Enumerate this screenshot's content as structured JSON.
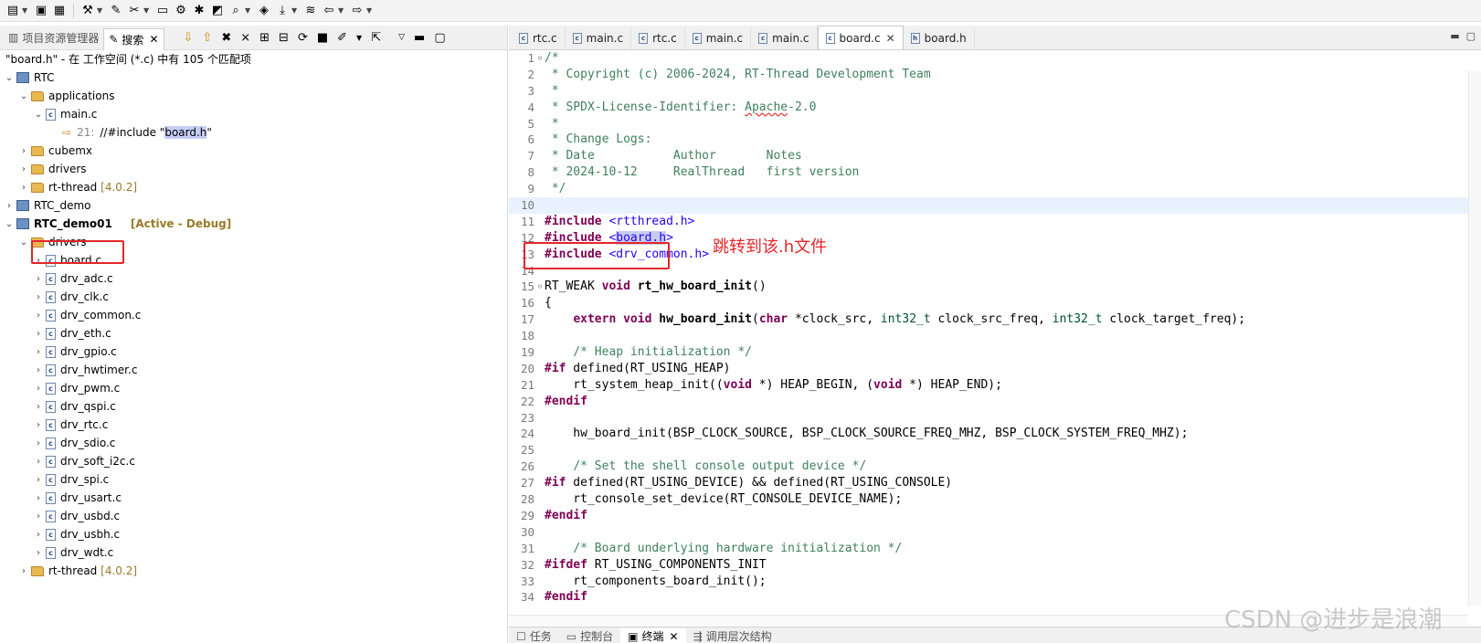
{
  "left_panel": {
    "tabs": [
      {
        "label": "项目资源管理器"
      },
      {
        "label": "搜索"
      }
    ],
    "summary": "\"board.h\" -  在 工作空间  (*.c)  中有 105 个匹配项",
    "tree": {
      "rtc": "RTC",
      "applications": "applications",
      "main_c": "main.c",
      "match_line": "21:",
      "match_prefix": "//#include \"",
      "match_highlight": "board.h",
      "match_suffix": "\"",
      "cubemx": "cubemx",
      "drivers": "drivers",
      "rt_thread": "rt-thread",
      "rt_thread_version": "[4.0.2]",
      "rtc_demo": "RTC_demo",
      "rtc_demo01": "RTC_demo01",
      "rtc_demo01_status": "[Active - Debug]",
      "drivers2": "drivers",
      "board_c": "board.c",
      "files": [
        "drv_adc.c",
        "drv_clk.c",
        "drv_common.c",
        "drv_eth.c",
        "drv_gpio.c",
        "drv_hwtimer.c",
        "drv_pwm.c",
        "drv_qspi.c",
        "drv_rtc.c",
        "drv_sdio.c",
        "drv_soft_i2c.c",
        "drv_spi.c",
        "drv_usart.c",
        "drv_usbd.c",
        "drv_usbh.c",
        "drv_wdt.c"
      ],
      "rt_thread2": "rt-thread",
      "rt_thread2_version": "[4.0.2]"
    }
  },
  "editor": {
    "tabs": [
      {
        "label": "rtc.c"
      },
      {
        "label": "main.c"
      },
      {
        "label": "rtc.c"
      },
      {
        "label": "main.c"
      },
      {
        "label": "main.c"
      },
      {
        "label": "board.c"
      },
      {
        "label": "board.h"
      }
    ],
    "annotation": "跳转到该.h文件"
  },
  "bottom_tabs": [
    {
      "label": "任务"
    },
    {
      "label": "控制台"
    },
    {
      "label": "终端"
    },
    {
      "label": "调用层次结构"
    }
  ],
  "watermark": "CSDN @进步是浪潮",
  "colors": {
    "highlight_box": "#e3262a",
    "comment": "#3f7f5f",
    "keyword": "#7f0055",
    "string": "#2a00ff"
  }
}
